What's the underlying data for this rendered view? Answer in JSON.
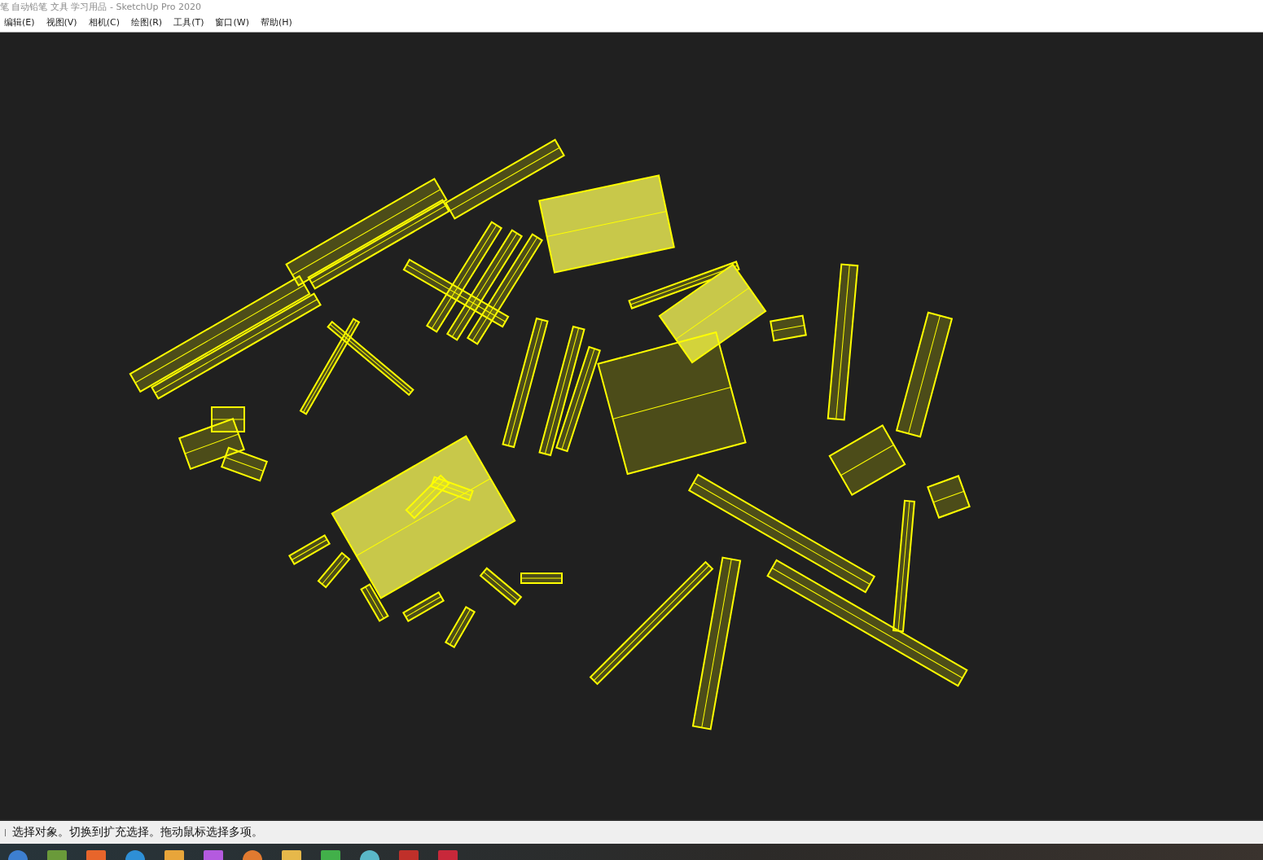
{
  "window": {
    "title": "笔 自动铅笔 文具 学习用品 - SketchUp Pro 2020"
  },
  "menu": [
    "编辑(E)",
    "视图(V)",
    "相机(C)",
    "绘图(R)",
    "工具(T)",
    "窗口(W)",
    "帮助(H)"
  ],
  "status_bar": {
    "text": "选择对象。切换到扩充选择。拖动鼠标选择多项。"
  }
}
